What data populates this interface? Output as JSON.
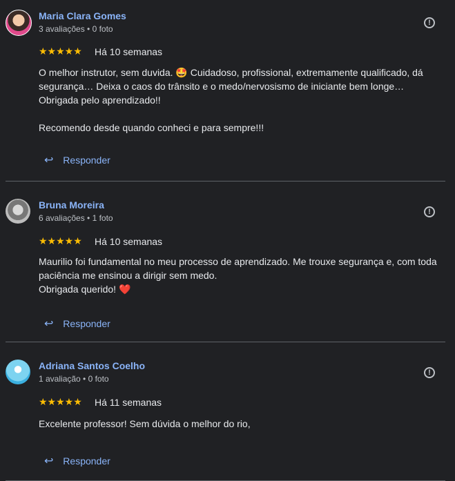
{
  "reviews": [
    {
      "name": "Maria Clara Gomes",
      "meta": "3 avaliações • 0 foto",
      "stars": "★★★★★",
      "date": "Há 10 semanas",
      "text": "O melhor instrutor, sem duvida. 🤩 Cuidadoso, profissional, extremamente qualificado, dá segurança… Deixa o caos do trânsito e o medo/nervosismo de iniciante bem longe… Obrigada pelo aprendizado!!\n\nRecomendo desde quando conheci e para sempre!!!",
      "reply": "Responder"
    },
    {
      "name": "Bruna Moreira",
      "meta": "6 avaliações • 1 foto",
      "stars": "★★★★★",
      "date": "Há 10 semanas",
      "text": "Maurilio foi fundamental no meu processo de aprendizado. Me trouxe segurança e, com toda paciência me ensinou a dirigir sem medo.\nObrigada querido! ❤️",
      "reply": "Responder"
    },
    {
      "name": "Adriana Santos Coelho",
      "meta": "1 avaliação • 0 foto",
      "stars": "★★★★★",
      "date": "Há 11 semanas",
      "text": "Excelente professor! Sem dúvida o melhor do rio,",
      "reply": "Responder"
    }
  ],
  "icons": {
    "flag": "report-flag-icon",
    "reply": "reply-arrow-icon"
  },
  "colors": {
    "background": "#202124",
    "link": "#8ab4f8",
    "star": "#fbbc04"
  }
}
